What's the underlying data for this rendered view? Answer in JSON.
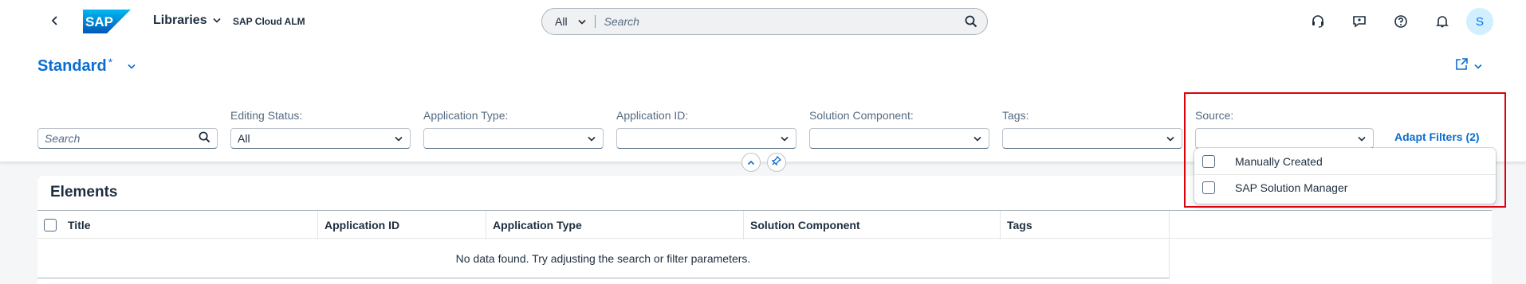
{
  "shell": {
    "product_label": "Libraries",
    "subtitle": "SAP Cloud ALM",
    "logo_text": "SAP",
    "search": {
      "scope": "All",
      "placeholder": "Search"
    },
    "avatar_initial": "S",
    "icons": [
      "back-icon",
      "headset-icon",
      "feedback-icon",
      "help-icon",
      "notification-bell-icon",
      "search-icon"
    ]
  },
  "header": {
    "variant": "Standard",
    "variant_modified": "*",
    "filters": [
      {
        "label": "",
        "value": "Search",
        "kind": "search"
      },
      {
        "label": "Editing Status:",
        "value": "All",
        "kind": "select"
      },
      {
        "label": "Application Type:",
        "value": "",
        "kind": "select"
      },
      {
        "label": "Application ID:",
        "value": "",
        "kind": "select"
      },
      {
        "label": "Solution Component:",
        "value": "",
        "kind": "select"
      },
      {
        "label": "Tags:",
        "value": "",
        "kind": "select"
      },
      {
        "label": "Source:",
        "value": "",
        "kind": "select"
      }
    ],
    "adapt_filters": "Adapt Filters (2)"
  },
  "table": {
    "title": "Elements",
    "columns": [
      "Title",
      "Application ID",
      "Application Type",
      "Solution Component",
      "Tags"
    ],
    "empty_text": "No data found. Try adjusting the search or filter parameters."
  },
  "source_dropdown": {
    "options": [
      "Manually Created",
      "SAP Solution Manager"
    ]
  },
  "colors": {
    "brand": "#0a6ed1",
    "highlight": "#e0000c",
    "text": "#1d2d3e"
  }
}
